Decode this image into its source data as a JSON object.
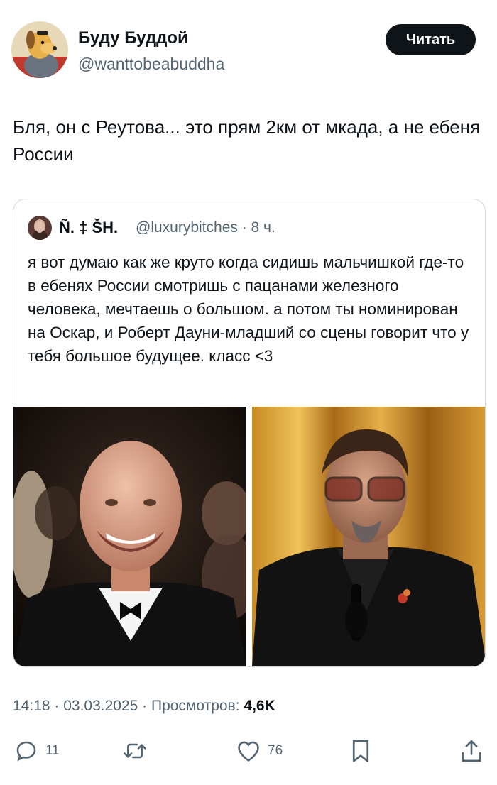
{
  "tweet": {
    "author_name": "Буду Буддой",
    "author_handle": "@wanttobeabuddha",
    "follow_label": "Читать",
    "text": "Бля, он с Реутова... это прям 2км от мкада, а не ебеня России",
    "timestamp": "14:18 · 03.03.2025 · Просмотров: ",
    "views": "4,6K"
  },
  "quote": {
    "author_name": "Ñ. ‡ ŠH.",
    "meta": "@luxurybitches · 8 ч.",
    "text": "я вот думаю как же круто когда сидишь мальчишкой где-то в ебенях России смотришь с пацанами железного человека, мечтаешь о большом. а потом ты номинирован на Оскар, и Роберт Дауни-младший со сцены говорит что у тебя большое будущее. класс <3"
  },
  "actions": {
    "reply_count": "11",
    "like_count": "76"
  },
  "colors": {
    "text": "#0f1419",
    "secondary": "#536471",
    "border": "#cfd9de",
    "button_bg": "#0f1419"
  }
}
